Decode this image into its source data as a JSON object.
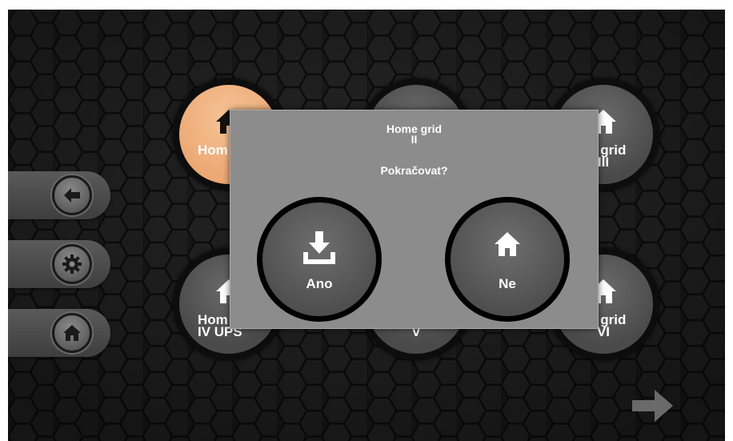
{
  "tiles": [
    {
      "label": "Home grid I",
      "active": true
    },
    {
      "label": "Home grid II",
      "active": false
    },
    {
      "label": "Home grid III",
      "active": false
    },
    {
      "label": "Home grid IV UPS",
      "active": false
    },
    {
      "label": "Home grid V",
      "active": false
    },
    {
      "label": "Home grid VI",
      "active": false
    }
  ],
  "visible_fragments": {
    "t1": "Hom",
    "t3": "ne grid",
    "t3b": "III",
    "t4": "Hom",
    "t4b": "IV UPS",
    "t5b": "V",
    "t6": "ne grid",
    "t6b": "VI"
  },
  "dialog": {
    "title_line1": "Home grid",
    "title_line2": "II",
    "question": "Pokračovat?",
    "yes_label": "Ano",
    "no_label": "Ne"
  },
  "side_buttons": [
    {
      "icon": "arrow-left-icon"
    },
    {
      "icon": "gear-icon"
    },
    {
      "icon": "home-icon"
    }
  ],
  "colors": {
    "active_tile": "#eda874",
    "tile": "#4f4f4f",
    "dialog": "#8c8c8c",
    "background": "#1c1c1c"
  }
}
